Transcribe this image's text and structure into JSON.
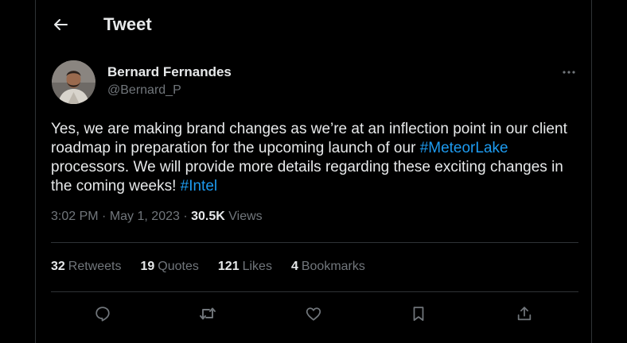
{
  "header": {
    "title": "Tweet"
  },
  "author": {
    "display_name": "Bernard Fernandes",
    "handle": "@Bernard_P"
  },
  "tweet": {
    "text_part1": "Yes, we are making brand changes as we’re at an inflection point in our client roadmap in preparation for the upcoming launch of our ",
    "hashtag1": "#MeteorLake",
    "text_part2": " processors. We will provide more details regarding these exciting changes in the coming weeks! ",
    "hashtag2": "#Intel"
  },
  "meta": {
    "time": "3:02 PM",
    "separator": "·",
    "date": "May 1, 2023",
    "views_count": "30.5K",
    "views_label": "Views"
  },
  "stats": [
    {
      "count": "32",
      "label": "Retweets"
    },
    {
      "count": "19",
      "label": "Quotes"
    },
    {
      "count": "121",
      "label": "Likes"
    },
    {
      "count": "4",
      "label": "Bookmarks"
    }
  ],
  "actions": [
    {
      "icon": "reply-icon"
    },
    {
      "icon": "retweet-icon"
    },
    {
      "icon": "like-icon"
    },
    {
      "icon": "bookmark-icon"
    },
    {
      "icon": "share-icon"
    }
  ],
  "colors": {
    "background": "#000000",
    "text_primary": "#e7e9ea",
    "text_secondary": "#71767b",
    "accent": "#1d9bf0",
    "divider": "#2f3336"
  }
}
